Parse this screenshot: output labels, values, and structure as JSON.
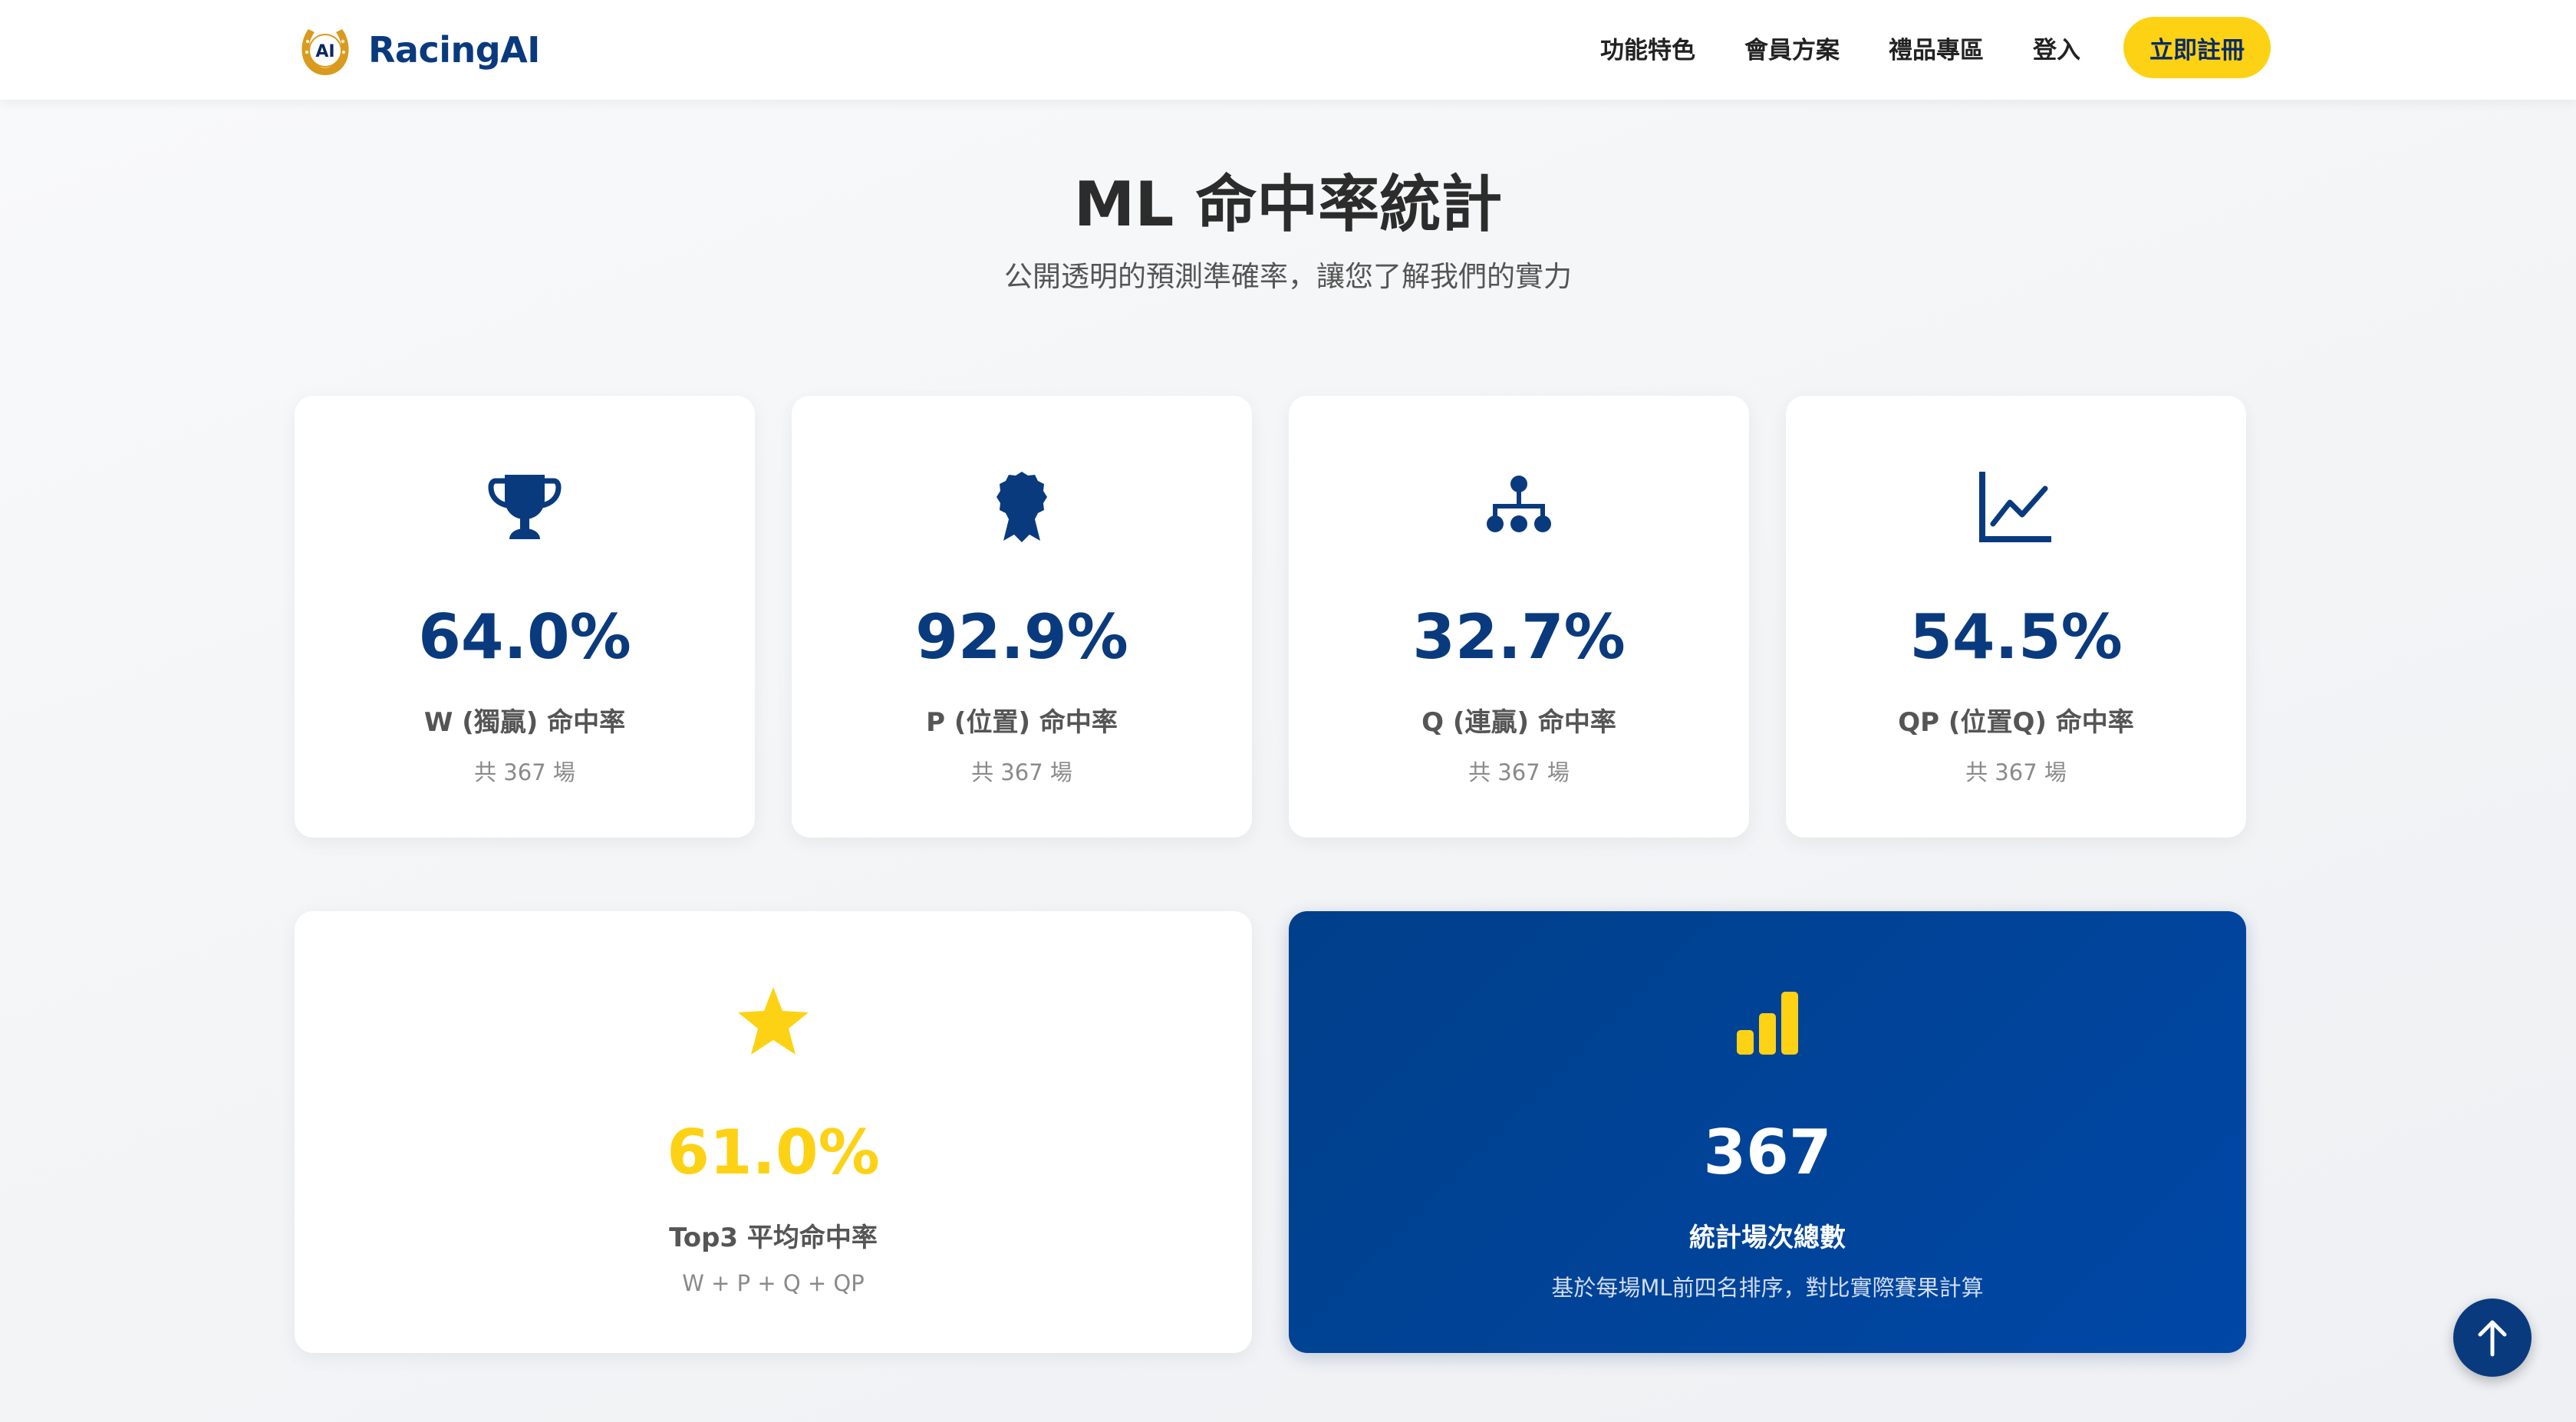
{
  "brand": {
    "name": "RacingAI",
    "logo_text": "AI"
  },
  "nav": {
    "links": [
      "功能特色",
      "會員方案",
      "禮品專區",
      "登入"
    ],
    "cta": "立即註冊"
  },
  "page": {
    "title": "ML 命中率統計",
    "subtitle": "公開透明的預測準確率，讓您了解我們的實力"
  },
  "stats": [
    {
      "icon": "trophy-icon",
      "value": "64.0%",
      "label": "W (獨贏) 命中率",
      "sub": "共 367 場"
    },
    {
      "icon": "award-icon",
      "value": "92.9%",
      "label": "P (位置) 命中率",
      "sub": "共 367 場"
    },
    {
      "icon": "sitemap-icon",
      "value": "32.7%",
      "label": "Q (連贏) 命中率",
      "sub": "共 367 場"
    },
    {
      "icon": "line-chart-icon",
      "value": "54.5%",
      "label": "QP (位置Q) 命中率",
      "sub": "共 367 場"
    }
  ],
  "summary": {
    "top3": {
      "icon": "star-icon",
      "value": "61.0%",
      "label": "Top3 平均命中率",
      "sub": "W + P + Q + QP"
    },
    "total": {
      "icon": "signal-bars-icon",
      "value": "367",
      "label": "統計場次總數",
      "sub": "基於每場ML前四名排序，對比實際賽果計算"
    }
  },
  "colors": {
    "primary": "#0a3a7e",
    "accent": "#fdd214",
    "card_blue": "#0047a6"
  }
}
